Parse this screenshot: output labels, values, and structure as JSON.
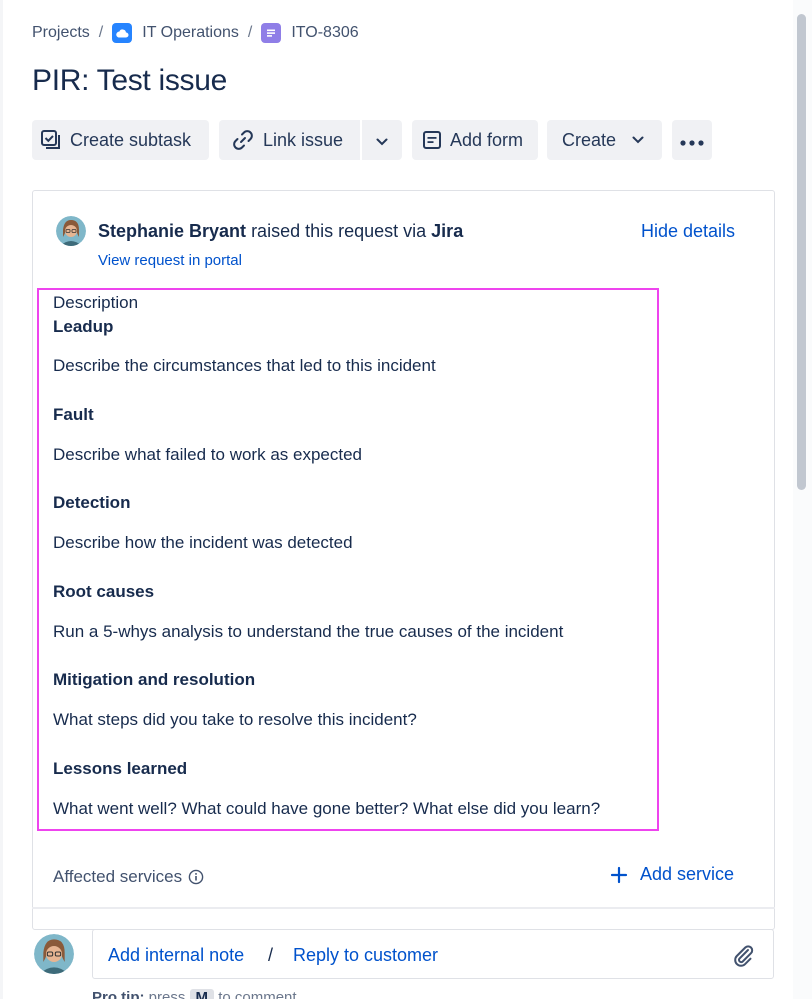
{
  "breadcrumb": {
    "projects": "Projects",
    "separator": "/",
    "project": "IT Operations",
    "issue_key": "ITO-8306"
  },
  "issue": {
    "title": "PIR: Test issue"
  },
  "toolbar": {
    "create_subtask": "Create subtask",
    "link_issue": "Link issue",
    "add_form": "Add form",
    "create": "Create"
  },
  "request": {
    "requester": "Stephanie Bryant",
    "raised_via_text": "raised this request via",
    "channel": "Jira",
    "hide_details": "Hide details",
    "view_portal": "View request in portal"
  },
  "description": {
    "label": "Description",
    "sections": [
      {
        "heading": "Leadup",
        "body": "Describe the circumstances that led to this incident"
      },
      {
        "heading": "Fault",
        "body": "Describe what failed to work as expected"
      },
      {
        "heading": "Detection",
        "body": "Describe how the incident was detected"
      },
      {
        "heading": "Root causes",
        "body": "Run a 5-whys analysis to understand the true causes of the incident"
      },
      {
        "heading": "Mitigation and resolution",
        "body": "What steps did you take to resolve this incident?"
      },
      {
        "heading": "Lessons learned",
        "body": "What went well? What could have gone better? What else did you learn?"
      }
    ]
  },
  "services": {
    "label": "Affected services",
    "add_label": "Add service"
  },
  "comment": {
    "add_internal_note": "Add internal note",
    "separator": "/",
    "reply_to_customer": "Reply to customer",
    "protip_label": "Pro tip:",
    "protip_text": "press",
    "protip_key": "M",
    "protip_suffix": "to comment"
  },
  "icons": {
    "project": "cloud-icon",
    "issue_type": "document-icon",
    "subtask": "subtask-icon",
    "link": "link-icon",
    "form": "form-icon",
    "more": "more-icon",
    "info": "info-icon",
    "add": "plus-icon",
    "attach": "paperclip-icon"
  },
  "colors": {
    "link": "#0052cc",
    "text": "#172b4d",
    "highlight": "#ee44ee",
    "project_icon": "#2684ff",
    "issue_icon": "#8f7ee7"
  }
}
